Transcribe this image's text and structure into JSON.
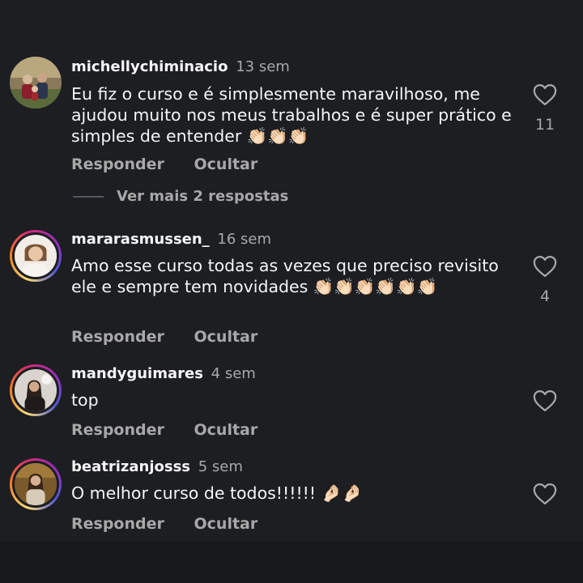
{
  "comments": [
    {
      "username": "michellychiminacio",
      "time": "13 sem",
      "text": "Eu fiz o curso e é simplesmente maravilhoso, me ajudou muito nos meus trabalhos e é super prático e simples de entender",
      "emoji": "👏🏻👏🏻👏🏻",
      "likes": "11",
      "reply_label": "Responder",
      "hide_label": "Ocultar",
      "more_replies": "Ver mais 2 respostas"
    },
    {
      "username": "mararasmussen_",
      "time": "16 sem",
      "text": "Amo esse curso todas as vezes que preciso revisito ele e sempre tem novidades",
      "emoji": "👏🏻👏🏻👏🏻👏🏻👏🏻👏🏻",
      "likes": "4",
      "reply_label": "Responder",
      "hide_label": "Ocultar"
    },
    {
      "username": "mandyguimares",
      "time": "4 sem",
      "text": "top",
      "emoji": "",
      "likes": "",
      "reply_label": "Responder",
      "hide_label": "Ocultar"
    },
    {
      "username": "beatrizanjosss",
      "time": "5 sem",
      "text": "O melhor curso de todos!!!!!!",
      "emoji": "🤌🏻🤌🏻",
      "likes": "",
      "reply_label": "Responder",
      "hide_label": "Ocultar"
    }
  ],
  "icons": {
    "like": "heart-outline-icon"
  },
  "colors": {
    "background": "#1c1e22",
    "secondary_text": "#a8a8a8",
    "primary_text": "#f5f5f5"
  }
}
